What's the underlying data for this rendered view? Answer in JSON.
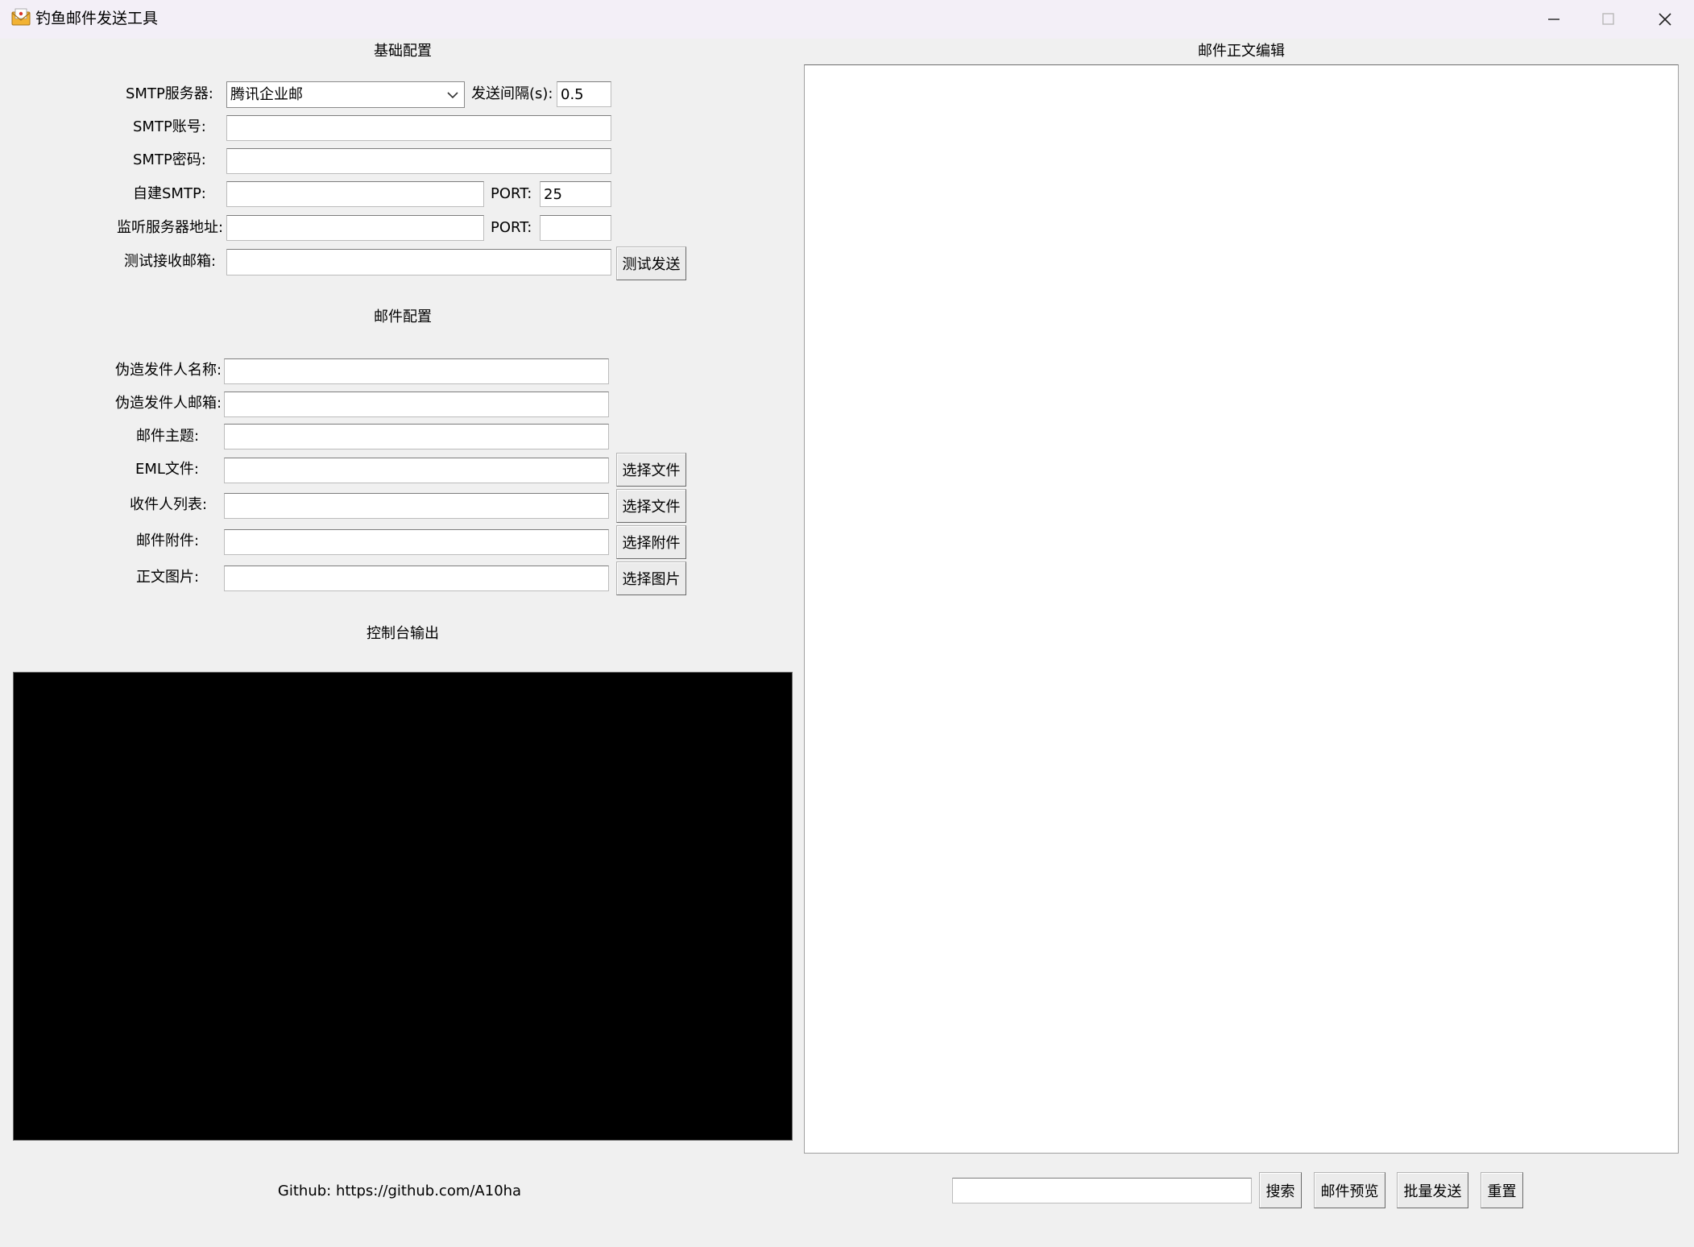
{
  "window": {
    "title": "钓鱼邮件发送工具",
    "icons": {
      "app": "envelope-icon",
      "minimize": "minimize-icon",
      "maximize": "maximize-icon",
      "close": "close-icon"
    }
  },
  "basic": {
    "heading": "基础配置",
    "smtp_server_label": "SMTP服务器:",
    "smtp_server_value": "腾讯企业邮",
    "interval_label": "发送间隔(s):",
    "interval_value": "0.5",
    "account_label": "SMTP账号:",
    "account_value": "",
    "password_label": "SMTP密码:",
    "password_value": "",
    "custom_smtp_label": "自建SMTP:",
    "custom_smtp_value": "",
    "port_label": "PORT:",
    "custom_port_value": "25",
    "listen_label": "监听服务器地址:",
    "listen_value": "",
    "listen_port_label": "PORT:",
    "listen_port_value": "",
    "test_recv_label": "测试接收邮箱:",
    "test_recv_value": "",
    "test_send_button": "测试发送"
  },
  "mail": {
    "heading": "邮件配置",
    "sender_name_label": "伪造发件人名称:",
    "sender_name_value": "",
    "sender_email_label": "伪造发件人邮箱:",
    "sender_email_value": "",
    "subject_label": "邮件主题:",
    "subject_value": "",
    "eml_label": "EML文件:",
    "eml_value": "",
    "eml_button": "选择文件",
    "recipients_label": "收件人列表:",
    "recipients_value": "",
    "recipients_button": "选择文件",
    "attachment_label": "邮件附件:",
    "attachment_value": "",
    "attachment_button": "选择附件",
    "image_label": "正文图片:",
    "image_value": "",
    "image_button": "选择图片"
  },
  "console": {
    "heading": "控制台输出"
  },
  "footer": {
    "github": "Github: https://github.com/A10ha"
  },
  "editor": {
    "heading": "邮件正文编辑",
    "search_value": "",
    "search_button": "搜索",
    "preview_button": "邮件预览",
    "batch_send_button": "批量发送",
    "reset_button": "重置"
  }
}
